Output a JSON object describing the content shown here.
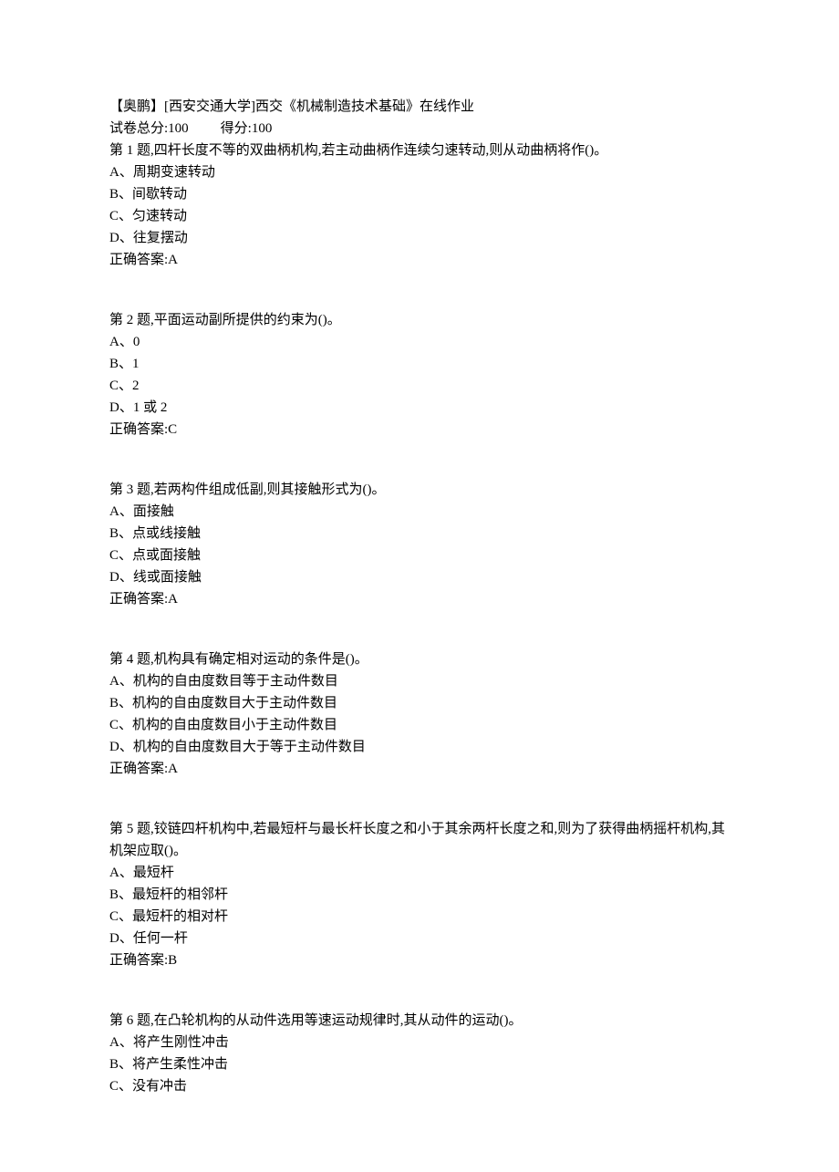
{
  "header": {
    "title": "【奥鹏】[西安交通大学]西交《机械制造技术基础》在线作业",
    "total_label": "试卷总分:100",
    "score_label": "得分:100"
  },
  "questions": [
    {
      "stem": "第 1 题,四杆长度不等的双曲柄机构,若主动曲柄作连续匀速转动,则从动曲柄将作()。",
      "options": [
        "A、周期变速转动",
        "B、间歇转动",
        "C、匀速转动",
        "D、往复摆动"
      ],
      "answer": "正确答案:A"
    },
    {
      "stem": "第 2 题,平面运动副所提供的约束为()。",
      "options": [
        "A、0",
        "B、1",
        "C、2",
        "D、1 或 2"
      ],
      "answer": "正确答案:C"
    },
    {
      "stem": "第 3 题,若两构件组成低副,则其接触形式为()。",
      "options": [
        "A、面接触",
        "B、点或线接触",
        "C、点或面接触",
        "D、线或面接触"
      ],
      "answer": "正确答案:A"
    },
    {
      "stem": "第 4 题,机构具有确定相对运动的条件是()。",
      "options": [
        "A、机构的自由度数目等于主动件数目",
        "B、机构的自由度数目大于主动件数目",
        "C、机构的自由度数目小于主动件数目",
        "D、机构的自由度数目大于等于主动件数目"
      ],
      "answer": "正确答案:A"
    },
    {
      "stem": "第 5 题,铰链四杆机构中,若最短杆与最长杆长度之和小于其余两杆长度之和,则为了获得曲柄摇杆机构,其机架应取()。",
      "options": [
        "A、最短杆",
        "B、最短杆的相邻杆",
        "C、最短杆的相对杆",
        "D、任何一杆"
      ],
      "answer": "正确答案:B"
    },
    {
      "stem": "第 6 题,在凸轮机构的从动件选用等速运动规律时,其从动件的运动()。",
      "options": [
        "A、将产生刚性冲击",
        "B、将产生柔性冲击",
        "C、没有冲击"
      ],
      "answer": ""
    }
  ]
}
